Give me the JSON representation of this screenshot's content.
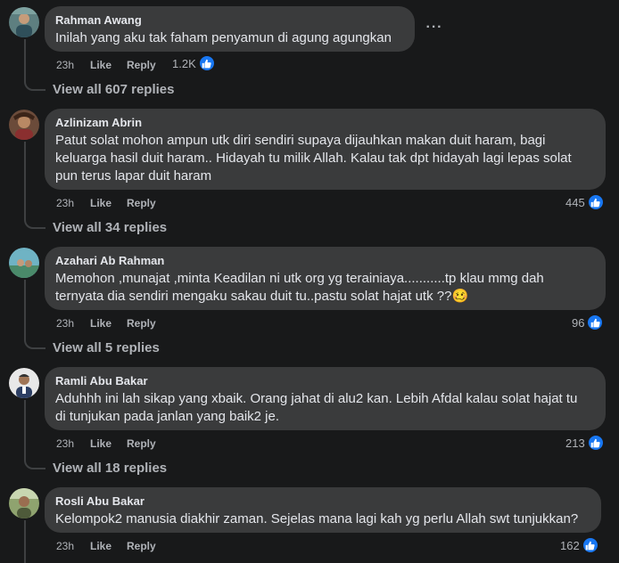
{
  "comments": [
    {
      "author": "Rahman Awang",
      "text": "Inilah yang aku tak faham penyamun di agung agungkan",
      "time": "23h",
      "like": "Like",
      "reply": "Reply",
      "reaction_count": "1.2K",
      "view_replies": "View all 607 replies",
      "more_icon": "···"
    },
    {
      "author": "Azlinizam Abrin",
      "text": "Patut solat mohon ampun utk diri sendiri supaya dijauhkan makan duit haram, bagi\nkeluarga hasil duit haram.. Hidayah tu milik Allah. Kalau tak dpt hidayah lagi lepas solat\npun terus lapar duit haram",
      "time": "23h",
      "like": "Like",
      "reply": "Reply",
      "reaction_count": "445",
      "view_replies": "View all 34 replies"
    },
    {
      "author": "Azahari Ab Rahman",
      "text": "Memohon ,munajat ,minta Keadilan ni utk org yg terainiaya...........tp klau mmg dah\nternyata dia sendiri mengaku sakau duit tu..pastu solat hajat utk ??🥴",
      "time": "23h",
      "like": "Like",
      "reply": "Reply",
      "reaction_count": "96",
      "view_replies": "View all 5 replies"
    },
    {
      "author": "Ramli Abu Bakar",
      "text": "Aduhhh ini lah sikap yang xbaik. Orang jahat di alu2 kan. Lebih Afdal kalau solat hajat tu\ndi tunjukan pada janlan yang baik2 je.",
      "time": "23h",
      "like": "Like",
      "reply": "Reply",
      "reaction_count": "213",
      "view_replies": "View all 18 replies"
    },
    {
      "author": "Rosli Abu Bakar",
      "text": "Kelompok2 manusia diakhir zaman. Sejelas mana lagi kah yg perlu Allah swt tunjukkan?",
      "time": "23h",
      "like": "Like",
      "reply": "Reply",
      "reaction_count": "162"
    }
  ],
  "icons": {
    "reaction": "like-thumb-icon",
    "more": "more-dots-icon"
  },
  "colors": {
    "background": "#18191a",
    "bubble": "#3a3b3c",
    "like_blue": "#1877f2",
    "muted_text": "#b0b3b8"
  }
}
